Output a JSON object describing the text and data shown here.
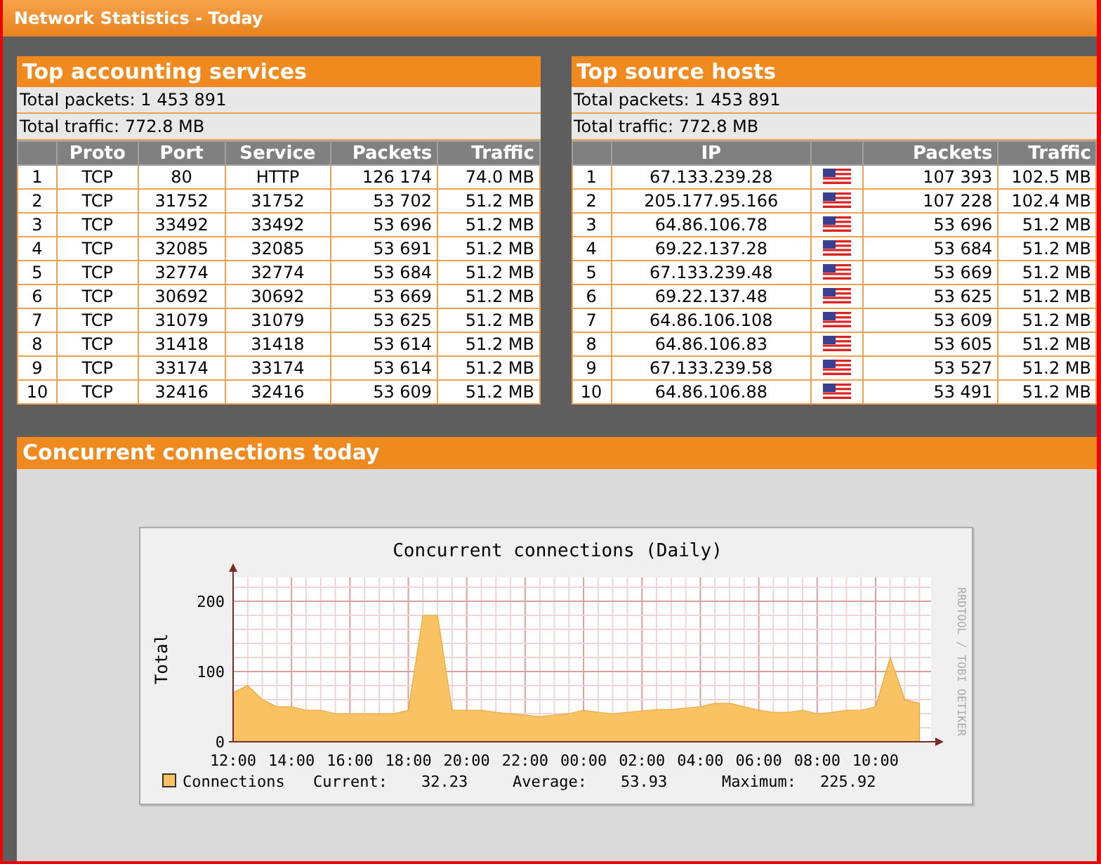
{
  "window": {
    "title": "Network Statistics - Today"
  },
  "panels": [
    {
      "title": "Top accounting services",
      "totals": [
        "Total packets: 1 453 891",
        "Total traffic: 772.8 MB"
      ],
      "columns": [
        {
          "label": "Proto",
          "kind": "text"
        },
        {
          "label": "Port",
          "kind": "text"
        },
        {
          "label": "Service",
          "kind": "text"
        },
        {
          "label": "Packets",
          "kind": "number"
        },
        {
          "label": "Traffic",
          "kind": "number"
        }
      ],
      "rows": [
        {
          "rank": "1",
          "cells": [
            "TCP",
            "80",
            "HTTP",
            "126 174",
            "74.0 MB"
          ]
        },
        {
          "rank": "2",
          "cells": [
            "TCP",
            "31752",
            "31752",
            "53 702",
            "51.2 MB"
          ]
        },
        {
          "rank": "3",
          "cells": [
            "TCP",
            "33492",
            "33492",
            "53 696",
            "51.2 MB"
          ]
        },
        {
          "rank": "4",
          "cells": [
            "TCP",
            "32085",
            "32085",
            "53 691",
            "51.2 MB"
          ]
        },
        {
          "rank": "5",
          "cells": [
            "TCP",
            "32774",
            "32774",
            "53 684",
            "51.2 MB"
          ]
        },
        {
          "rank": "6",
          "cells": [
            "TCP",
            "30692",
            "30692",
            "53 669",
            "51.2 MB"
          ]
        },
        {
          "rank": "7",
          "cells": [
            "TCP",
            "31079",
            "31079",
            "53 625",
            "51.2 MB"
          ]
        },
        {
          "rank": "8",
          "cells": [
            "TCP",
            "31418",
            "31418",
            "53 614",
            "51.2 MB"
          ]
        },
        {
          "rank": "9",
          "cells": [
            "TCP",
            "33174",
            "33174",
            "53 614",
            "51.2 MB"
          ]
        },
        {
          "rank": "10",
          "cells": [
            "TCP",
            "32416",
            "32416",
            "53 609",
            "51.2 MB"
          ]
        }
      ]
    },
    {
      "title": "Top source hosts",
      "totals": [
        "Total packets: 1 453 891",
        "Total traffic: 772.8 MB"
      ],
      "columns": [
        {
          "label": "IP",
          "kind": "text"
        },
        {
          "kind": "flag"
        },
        {
          "label": "Packets",
          "kind": "number"
        },
        {
          "label": "Traffic",
          "kind": "number"
        }
      ],
      "rows": [
        {
          "rank": "1",
          "cells": [
            "67.133.239.28",
            "",
            "107 393",
            "102.5 MB"
          ]
        },
        {
          "rank": "2",
          "cells": [
            "205.177.95.166",
            "",
            "107 228",
            "102.4 MB"
          ]
        },
        {
          "rank": "3",
          "cells": [
            "64.86.106.78",
            "",
            "53 696",
            "51.2 MB"
          ]
        },
        {
          "rank": "4",
          "cells": [
            "69.22.137.28",
            "",
            "53 684",
            "51.2 MB"
          ]
        },
        {
          "rank": "5",
          "cells": [
            "67.133.239.48",
            "",
            "53 669",
            "51.2 MB"
          ]
        },
        {
          "rank": "6",
          "cells": [
            "69.22.137.48",
            "",
            "53 625",
            "51.2 MB"
          ]
        },
        {
          "rank": "7",
          "cells": [
            "64.86.106.108",
            "",
            "53 609",
            "51.2 MB"
          ]
        },
        {
          "rank": "8",
          "cells": [
            "64.86.106.83",
            "",
            "53 605",
            "51.2 MB"
          ]
        },
        {
          "rank": "9",
          "cells": [
            "67.133.239.58",
            "",
            "53 527",
            "51.2 MB"
          ]
        },
        {
          "rank": "10",
          "cells": [
            "64.86.106.88",
            "",
            "53 491",
            "51.2 MB"
          ]
        }
      ]
    }
  ],
  "connections": {
    "title": "Concurrent connections today",
    "credit": "RRDTOOL / TOBI OETIKER",
    "stats": [
      {
        "label": "Current:",
        "value": "32.23"
      },
      {
        "label": "Average:",
        "value": "53.93"
      },
      {
        "label": "Maximum:",
        "value": "225.92"
      }
    ],
    "chart_data": {
      "type": "area",
      "title": "Concurrent connections (Daily)",
      "ylabel": "Total",
      "categories": [
        "12:00",
        null,
        null,
        null,
        "14:00",
        null,
        null,
        null,
        "16:00",
        null,
        null,
        null,
        "18:00",
        null,
        null,
        null,
        "20:00",
        null,
        null,
        null,
        "22:00",
        null,
        null,
        null,
        "00:00",
        null,
        null,
        null,
        "02:00",
        null,
        null,
        null,
        "04:00",
        null,
        null,
        null,
        "06:00",
        null,
        null,
        null,
        "08:00",
        null,
        null,
        null,
        "10:00",
        null,
        null,
        null
      ],
      "series": [
        {
          "name": "Connections",
          "color": "#f9c364",
          "values": [
            70,
            80,
            60,
            50,
            50,
            45,
            45,
            40,
            40,
            40,
            40,
            40,
            45,
            180,
            180,
            45,
            45,
            45,
            42,
            40,
            38,
            36,
            38,
            40,
            45,
            42,
            40,
            42,
            44,
            46,
            46,
            48,
            50,
            55,
            55,
            50,
            45,
            42,
            42,
            45,
            40,
            42,
            45,
            45,
            50,
            120,
            60,
            55
          ]
        }
      ],
      "ylim": [
        0,
        234
      ],
      "grid": true,
      "yticks": [
        0,
        100,
        200
      ]
    }
  }
}
